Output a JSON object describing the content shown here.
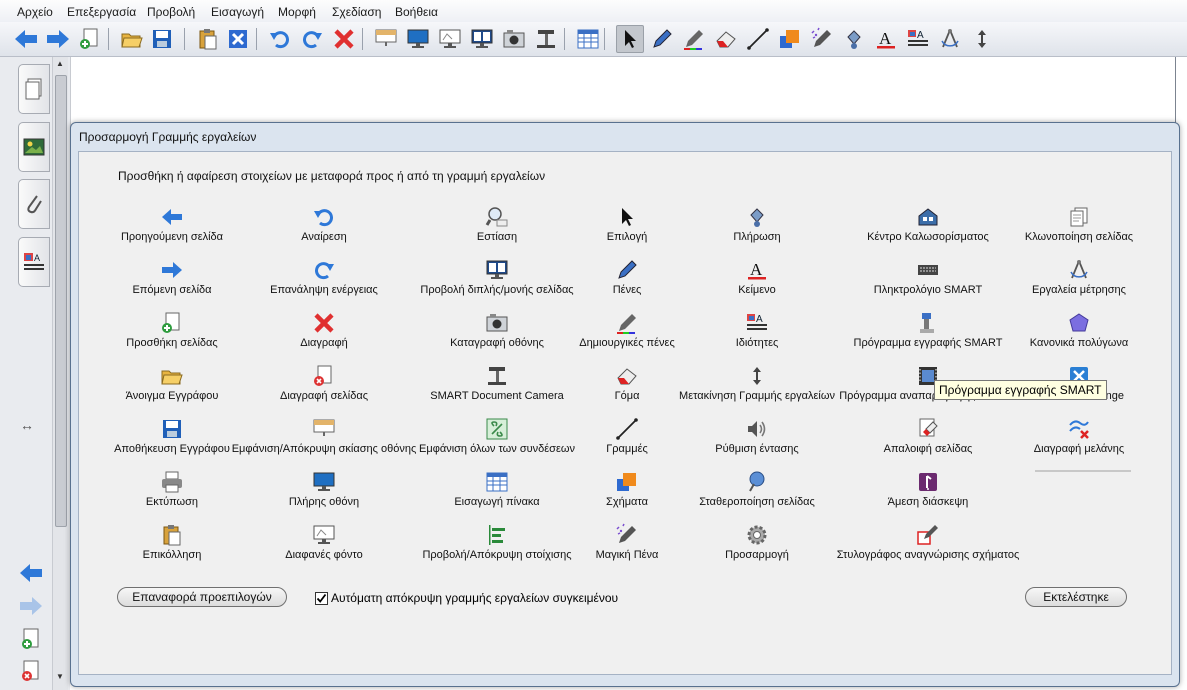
{
  "menubar": [
    "Αρχείο",
    "Επεξεργασία",
    "Προβολή",
    "Εισαγωγή",
    "Μορφή",
    "Σχεδίαση",
    "Βοήθεια"
  ],
  "toolbar": {
    "buttons": [
      "previous-page",
      "next-page",
      "add-page",
      "open",
      "save",
      "paste",
      "delete-page",
      "undo",
      "redo",
      "delete",
      "screen-shade",
      "full-screen",
      "transparent",
      "dual-view",
      "screen-capture",
      "document-camera",
      "table",
      "select",
      "pens",
      "creative-pens",
      "eraser",
      "lines",
      "shapes",
      "magic-pen",
      "fill",
      "text",
      "properties",
      "measurement",
      "move-toolbar"
    ],
    "selected": "select"
  },
  "dialog": {
    "title": "Προσαρμογή Γραμμής εργαλείων",
    "instruction": "Προσθήκη ή αφαίρεση στοιχείων με μεταφορά προς ή από τη γραμμή εργαλείων",
    "items": [
      {
        "label": "Προηγούμενη σελίδα",
        "icon": "arrow-left-icon"
      },
      {
        "label": "Αναίρεση",
        "icon": "undo-icon"
      },
      {
        "label": "Εστίαση",
        "icon": "magnifier-icon"
      },
      {
        "label": "Επιλογή",
        "icon": "cursor-icon"
      },
      {
        "label": "Πλήρωση",
        "icon": "paint-bucket-icon"
      },
      {
        "label": "Κέντρο Καλωσορίσματος",
        "icon": "home-icon"
      },
      {
        "label": "Κλωνοποίηση σελίδας",
        "icon": "clone-page-icon"
      },
      {
        "label": "Επόμενη σελίδα",
        "icon": "arrow-right-icon"
      },
      {
        "label": "Επανάληψη ενέργειας",
        "icon": "redo-icon"
      },
      {
        "label": "Προβολή διπλής/μονής σελίδας",
        "icon": "dual-view-icon"
      },
      {
        "label": "Πένες",
        "icon": "pen-icon"
      },
      {
        "label": "Κείμενο",
        "icon": "text-icon"
      },
      {
        "label": "Πληκτρολόγιο SMART",
        "icon": "keyboard-icon"
      },
      {
        "label": "Εργαλεία μέτρησης",
        "icon": "compass-icon"
      },
      {
        "label": "Προσθήκη σελίδας",
        "icon": "add-page-icon"
      },
      {
        "label": "Διαγραφή",
        "icon": "red-x-icon"
      },
      {
        "label": "Καταγραφή οθόνης",
        "icon": "camera-icon"
      },
      {
        "label": "Δημιουργικές πένες",
        "icon": "creative-pen-icon"
      },
      {
        "label": "Ιδιότητες",
        "icon": "properties-icon"
      },
      {
        "label": "Πρόγραμμα εγγραφής SMART",
        "icon": "recorder-icon"
      },
      {
        "label": "Κανονικά πολύγωνα",
        "icon": "polygon-icon"
      },
      {
        "label": "Άνοιγμα Εγγράφου",
        "icon": "folder-open-icon"
      },
      {
        "label": "Διαγραφή σελίδας",
        "icon": "delete-page-icon"
      },
      {
        "label": "SMART Document Camera",
        "icon": "document-camera-icon"
      },
      {
        "label": "Γόμα",
        "icon": "eraser-icon"
      },
      {
        "label": "Μετακίνηση Γραμμής εργαλείων",
        "icon": "move-updown-icon"
      },
      {
        "label": "Πρόγραμμα αναπαραγωγής SMART",
        "icon": "film-icon"
      },
      {
        "label": "SMART Exchange",
        "icon": "exchange-icon"
      },
      {
        "label": "Αποθήκευση Εγγράφου",
        "icon": "save-icon"
      },
      {
        "label": "Εμφάνιση/Απόκρυψη σκίασης οθόνης",
        "icon": "screen-shade-icon"
      },
      {
        "label": "Εμφάνιση όλων των συνδέσεων",
        "icon": "links-icon"
      },
      {
        "label": "Γραμμές",
        "icon": "line-icon"
      },
      {
        "label": "Ρύθμιση έντασης",
        "icon": "speaker-icon"
      },
      {
        "label": "Απαλοιφή σελίδας",
        "icon": "clear-page-icon"
      },
      {
        "label": "Διαγραφή μελάνης",
        "icon": "clear-ink-icon"
      },
      {
        "label": "Εκτύπωση",
        "icon": "printer-icon"
      },
      {
        "label": "Πλήρης οθόνη",
        "icon": "monitor-icon"
      },
      {
        "label": "Εισαγωγή πίνακα",
        "icon": "table-icon"
      },
      {
        "label": "Σχήματα",
        "icon": "shapes-icon"
      },
      {
        "label": "Σταθεροποίηση σελίδας",
        "icon": "pin-icon"
      },
      {
        "label": "Άμεση διάσκεψη",
        "icon": "bridgit-icon"
      },
      {
        "label": "",
        "icon": ""
      },
      {
        "label": "Επικόλληση",
        "icon": "paste-icon"
      },
      {
        "label": "Διαφανές φόντο",
        "icon": "transparent-monitor-icon"
      },
      {
        "label": "Προβολή/Απόκρυψη στοίχισης",
        "icon": "align-icon"
      },
      {
        "label": "Μαγική Πένα",
        "icon": "magic-pen-icon"
      },
      {
        "label": "Προσαρμογή",
        "icon": "gear-icon"
      },
      {
        "label": "Στυλογράφος αναγνώρισης σχήματος",
        "icon": "shape-pen-icon"
      },
      {
        "label": "",
        "icon": ""
      }
    ],
    "reset_label": "Επαναφορά προεπιλογών",
    "checkbox_label": "Αυτόματη απόκρυψη γραμμής εργαλείων συγκειμένου",
    "checkbox_checked": true,
    "done_label": "Εκτελέστηκε",
    "tooltip": "Πρόγραμμα εγγραφής SMART"
  }
}
